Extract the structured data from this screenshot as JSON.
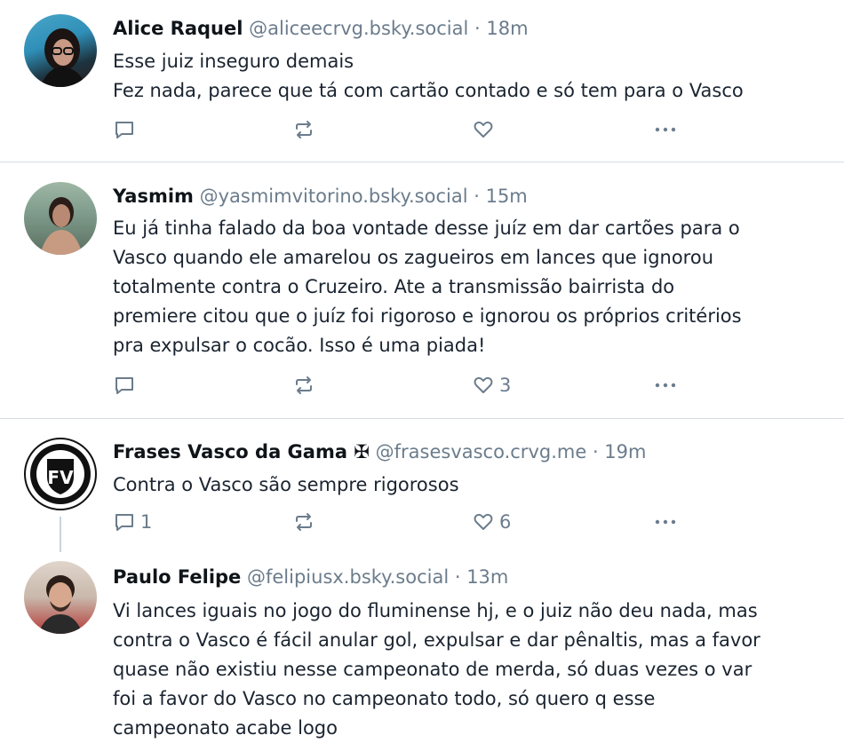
{
  "posts": [
    {
      "name": "Alice Raquel",
      "handle": "@aliceecrvg.bsky.social",
      "time": "· 18m",
      "lines": [
        "Esse juiz inseguro demais",
        "Fez nada, parece que tá com cartão contado e só tem para o Vasco"
      ],
      "replies": "",
      "likes": ""
    },
    {
      "name": "Yasmim",
      "handle": "@yasmimvitorino.bsky.social",
      "time": "· 15m",
      "lines": [
        "Eu já tinha falado da boa vontade desse juíz em dar cartões para o",
        "Vasco quando ele amarelou os zagueiros em lances que ignorou",
        "totalmente contra o Cruzeiro. Ate a transmissão bairrista do",
        "premiere citou que o juíz foi rigoroso e ignorou os próprios critérios",
        "pra expulsar o cocão. Isso é uma piada!"
      ],
      "replies": "",
      "likes": "3"
    },
    {
      "name": "Frases Vasco da Gama ✠",
      "handle": "@frasesvasco.crvg.me",
      "time": "· 19m",
      "lines": [
        "Contra o Vasco são sempre rigorosos"
      ],
      "replies": "1",
      "likes": "6",
      "avatar_text": "FV"
    },
    {
      "name": "Paulo Felipe",
      "handle": "@felipiusx.bsky.social",
      "time": "· 13m",
      "lines": [
        "Vi lances iguais no jogo do fluminense hj, e o juiz não deu nada, mas",
        "contra o Vasco é fácil anular gol, expulsar e dar pênaltis, mas a favor",
        "quase não existiu nesse campeonato de merda, só duas vezes o var",
        "foi a favor do Vasco no campeonato todo, só quero q esse",
        "campeonato acabe logo"
      ]
    }
  ],
  "colors": {
    "muted": "#6b7c8c",
    "divider": "#d6dde4"
  },
  "icons": [
    "reply-icon",
    "repost-icon",
    "like-icon",
    "more-icon"
  ]
}
